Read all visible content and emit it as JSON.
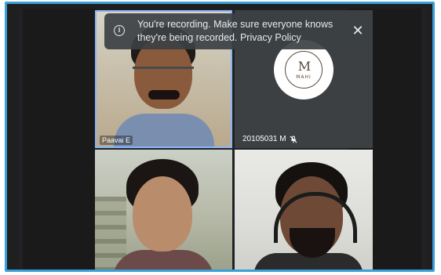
{
  "toast": {
    "message_line1": "You're recording. Make sure everyone knows",
    "message_line2": "they're being recorded. Privacy Policy",
    "close_glyph": "✕",
    "info_glyph": "i"
  },
  "tiles": [
    {
      "name": "Paavai E"
    },
    {
      "name": "20105031 M",
      "muted": true,
      "logo_mark": "M",
      "logo_word": "MAHI"
    },
    {
      "name": ""
    },
    {
      "name": ""
    }
  ],
  "colors": {
    "frame_border": "#3aa0d8",
    "active_speaker_border": "#8ab4f8",
    "stage_bg": "#202124",
    "toast_bg": "#3c4043"
  }
}
